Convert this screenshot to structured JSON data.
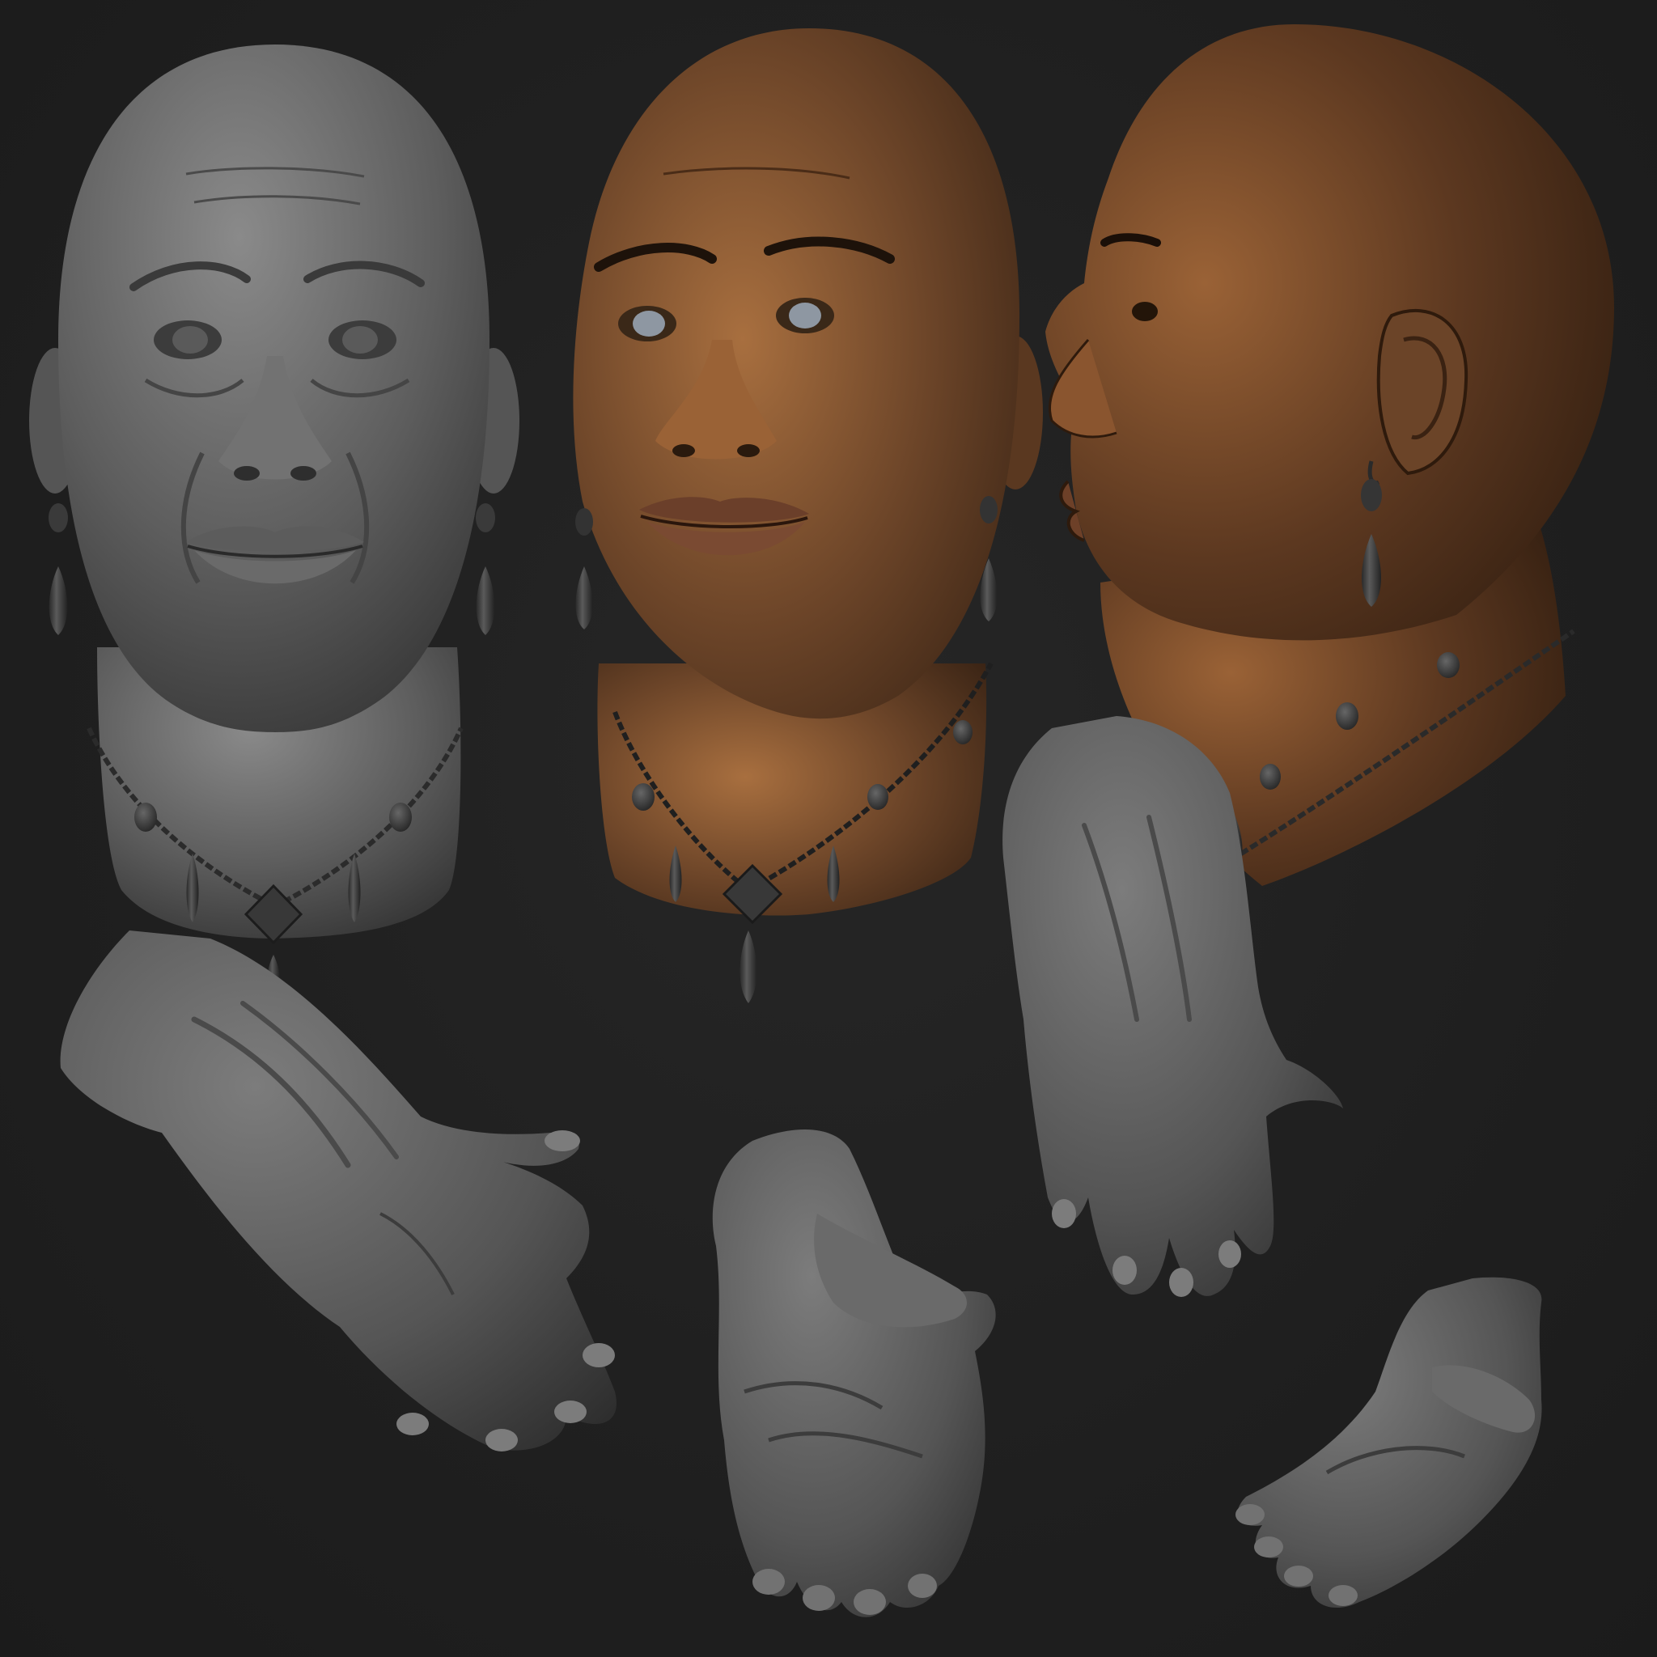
{
  "scene": {
    "background_color": "#202020",
    "clay_color": "#6f6f6f",
    "skin_color": "#6b4428",
    "skin_highlight_color": "#a06a3c",
    "jewelry_color": "#3c3c3c",
    "eye_color": "#8e97a2"
  },
  "objects": {
    "head_clay_front": {
      "material": "clay",
      "view": "front"
    },
    "head_skin_three_quarter": {
      "material": "skin",
      "view": "three-quarter"
    },
    "head_skin_profile": {
      "material": "skin",
      "view": "profile"
    },
    "hand_back_large": {
      "material": "clay",
      "view": "back"
    },
    "hand_back_small": {
      "material": "clay",
      "view": "back"
    },
    "hand_palm_center": {
      "material": "clay",
      "view": "palm"
    },
    "hand_palm_right": {
      "material": "clay",
      "view": "palm"
    }
  }
}
